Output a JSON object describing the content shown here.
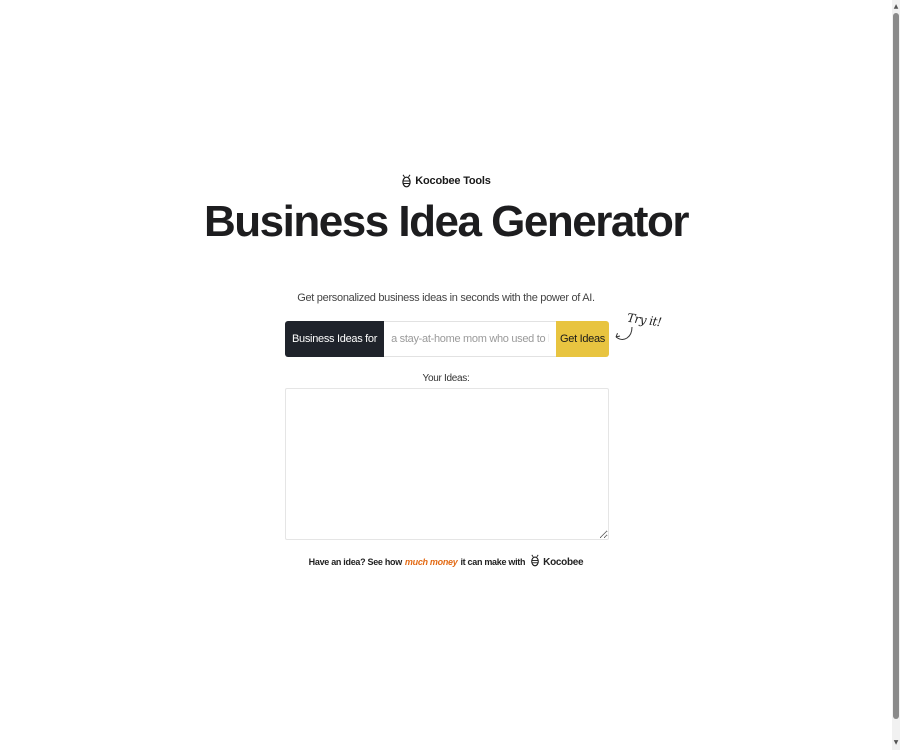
{
  "brand": {
    "name": "Kocobee Tools",
    "icon": "bee-icon"
  },
  "hero": {
    "title": "Business Idea Generator",
    "subtitle": "Get personalized business ideas in seconds with the power of AI."
  },
  "form": {
    "prefix_label": "Business Ideas for",
    "input_placeholder": "a stay-at-home mom who used to be a teacher",
    "input_value": "",
    "submit_label": "Get Ideas",
    "hint_text": "Try it!"
  },
  "results": {
    "label": "Your Ideas:",
    "value": ""
  },
  "footer": {
    "text_before": "Have an idea? See how",
    "link_text": "much money",
    "text_after": "it can make with",
    "brand_name": "Kocobee",
    "link_color": "#e36a14"
  },
  "colors": {
    "prefix_bg": "#1f232b",
    "button_bg": "#e8c440"
  },
  "scrollbar": {
    "up_icon": "scroll-up-arrow-icon",
    "down_icon": "scroll-down-arrow-icon"
  }
}
